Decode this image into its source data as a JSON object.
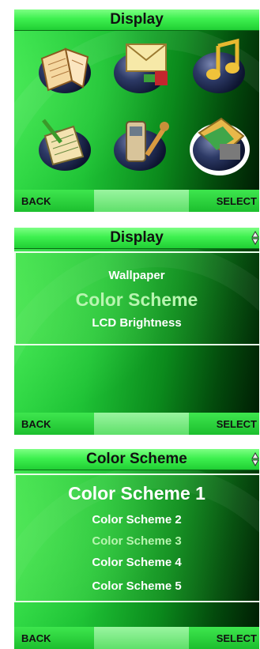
{
  "screen1": {
    "title": "Display",
    "icons": [
      "book-icon",
      "mail-icon",
      "music-icon",
      "notes-icon",
      "phone-tools-icon",
      "media-icon"
    ],
    "softkeys": {
      "left": "BACK",
      "right": "SELECT"
    }
  },
  "screen2": {
    "title": "Display",
    "items": [
      {
        "label": "Wallpaper",
        "highlighted": false
      },
      {
        "label": "Color Scheme",
        "highlighted": true
      },
      {
        "label": "LCD Brightness",
        "highlighted": false
      }
    ],
    "softkeys": {
      "left": "BACK",
      "right": "SELECT"
    }
  },
  "screen3": {
    "title": "Color Scheme",
    "items": [
      {
        "label": "Color Scheme 1",
        "highlighted": false
      },
      {
        "label": "Color Scheme 2",
        "highlighted": false
      },
      {
        "label": "Color Scheme 3",
        "highlighted": true
      },
      {
        "label": "Color Scheme 4",
        "highlighted": false
      },
      {
        "label": "Color Scheme 5",
        "highlighted": false
      }
    ],
    "softkeys": {
      "left": "BACK",
      "right": "SELECT"
    }
  },
  "colors": {
    "title_text": "#111111",
    "highlight_text": "#b8f5b0",
    "item_text": "#ffffff"
  }
}
